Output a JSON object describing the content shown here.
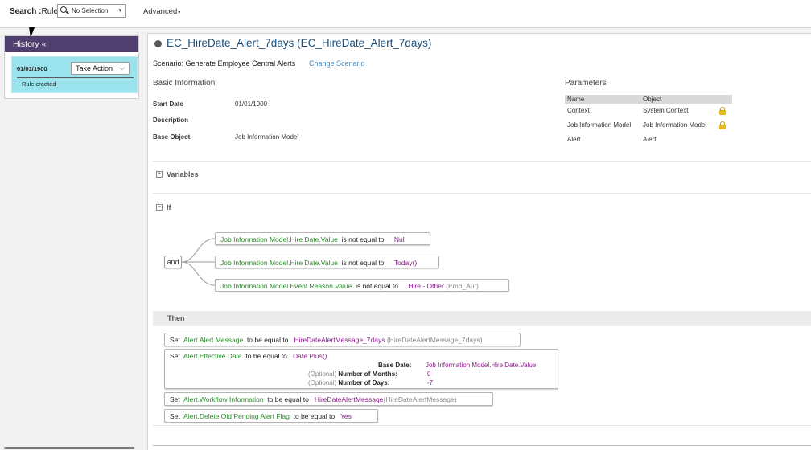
{
  "topbar": {
    "search_label_bold": "Search :",
    "search_label_rest": "Rule",
    "search_value": "No Selection",
    "advanced_label": "Advanced"
  },
  "history": {
    "title": "History «",
    "date": "01/01/1900",
    "take_action": "Take Action",
    "note": "Rule created"
  },
  "rule": {
    "title": "EC_HireDate_Alert_7days (EC_HireDate_Alert_7days)",
    "scenario_text": "Scenario: Generate Employee Central Alerts",
    "change_scenario": "Change Scenario"
  },
  "basic_info": {
    "title": "Basic Information",
    "start_date_label": "Start Date",
    "start_date_value": "01/01/1900",
    "description_label": "Description",
    "base_object_label": "Base Object",
    "base_object_value": "Job Information Model"
  },
  "parameters": {
    "title": "Parameters",
    "columns": [
      "Name",
      "Object"
    ],
    "rows": [
      {
        "name": "Context",
        "object": "System Context",
        "locked": true
      },
      {
        "name": "Job Information Model",
        "object": "Job Information Model",
        "locked": true
      },
      {
        "name": "Alert",
        "object": "Alert",
        "locked": false
      }
    ]
  },
  "variables": {
    "label": "Variables"
  },
  "if_block": {
    "label": "If",
    "operator": "and",
    "conditions": [
      {
        "field": "Job Information Model.Hire Date.Value",
        "op": "is not equal to",
        "value": "Null",
        "extra": ""
      },
      {
        "field": "Job Information Model.Hire Date.Value",
        "op": "is not equal to",
        "value": "Today()",
        "extra": ""
      },
      {
        "field": "Job Information Model.Event Reason.Value",
        "op": "is not equal to",
        "value": "Hire - Other",
        "extra": "(Emb_Aut)"
      }
    ]
  },
  "then_block": {
    "label": "Then",
    "set_word": "Set",
    "op": "to be equal to",
    "actions": [
      {
        "field": "Alert.Alert Message",
        "value": "HireDateAlertMessage_7days",
        "extra": "(HireDateAlertMessage_7days)"
      },
      {
        "field": "Alert.Effective Date",
        "value": "Date Plus()",
        "extra": ""
      },
      {
        "field": "Alert.Workflow Information",
        "value": "HireDateAlertMessage",
        "extra": "(HireDateAlertMessage)"
      },
      {
        "field": "Alert.Delete Old Pending Alert Flag",
        "value": "Yes",
        "extra": ""
      }
    ],
    "date_plus_params": [
      {
        "optional": "",
        "name": "Base Date:",
        "value": "Job Information Model.Hire Date.Value"
      },
      {
        "optional": "(Optional)",
        "name": "Number of Months:",
        "value": "0"
      },
      {
        "optional": "(Optional)",
        "name": "Number of Days:",
        "value": "-7"
      }
    ]
  },
  "colors": {
    "history_header": "#4f3f6e",
    "history_card": "#9be3ec",
    "title_blue": "#1d4f7a",
    "link_blue": "#4a8ec4",
    "field_green": "#2b8a2b",
    "value_purple": "#8a1b8a",
    "lock_yellow": "#e7b823"
  }
}
